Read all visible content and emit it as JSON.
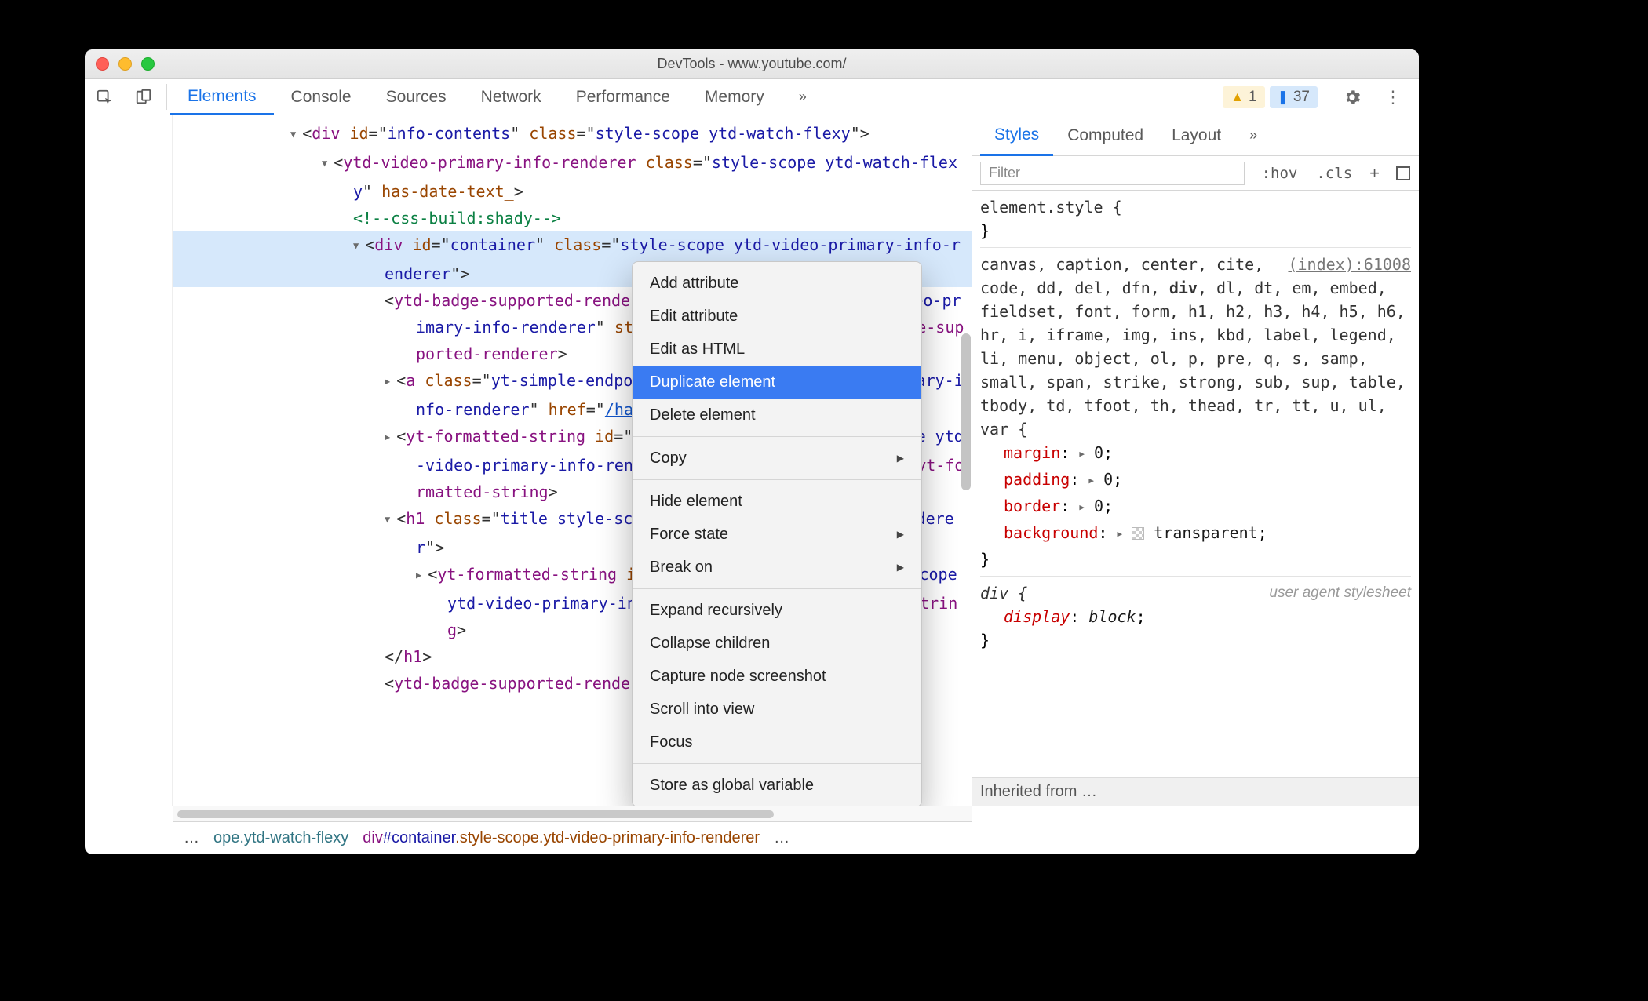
{
  "title": "DevTools - www.youtube.com/",
  "toolbar_tabs": {
    "elements": "Elements",
    "console": "Console",
    "sources": "Sources",
    "network": "Network",
    "performance": "Performance",
    "memory": "Memory"
  },
  "warnings_count": "1",
  "messages_count": "37",
  "dom": {
    "l1": "<div id=\"info-contents\" class=\"style-scope ytd-watch-flexy\">",
    "l2": "<ytd-video-primary-info-renderer class=\"style-scope ytd-watch-flexy\" has-date-text_>",
    "l3": "<!--css-build:shady-->",
    "l4": "<div id=\"container\" class=\"style-scope ytd-video-primary-info-renderer\">",
    "l5": "<ytd-badge-supported-renderer class=\"style-scope ytd-video-primary-info-renderer\" style-upgrade hidden>…</ytd-badge-supported-renderer>",
    "l6_pre": "<a class=\"yt-simple-endpoint style-scope ytd-video-primary-info-renderer\" href=\"",
    "l6_link": "/hashtag/chromedevsummit",
    "l6_post": "\">…</a>",
    "l7": "<yt-formatted-string id=\"super-title\" class=\"style-scope ytd-video-primary-info-renderer\" force-default-style>…</yt-formatted-string>",
    "l8": "<h1 class=\"title style-scope ytd-video-primary-info-renderer\">",
    "l9": "<yt-formatted-string id=\"video-title\" class=\"style-scope ytd-video-primary-info-renderer\">…</yt-formatted-string>",
    "l10": "</h1>",
    "l11": "<ytd-badge-supported-renderer class=\"style-scop"
  },
  "gutter_dots": "…",
  "context_menu": {
    "add_attribute": "Add attribute",
    "edit_attribute": "Edit attribute",
    "edit_html": "Edit as HTML",
    "duplicate": "Duplicate element",
    "delete": "Delete element",
    "copy": "Copy",
    "hide": "Hide element",
    "force_state": "Force state",
    "break_on": "Break on",
    "expand": "Expand recursively",
    "collapse": "Collapse children",
    "capture": "Capture node screenshot",
    "scroll": "Scroll into view",
    "focus": "Focus",
    "store": "Store as global variable"
  },
  "breadcrumb": {
    "dots_left": "…",
    "c1": "ope.ytd-watch-flexy",
    "c2_tag": "div",
    "c2_id": "#container",
    "c2_cls": ".style-scope.ytd-video-primary-info-renderer",
    "dots_right": "…"
  },
  "styles_panel": {
    "tabs": {
      "styles": "Styles",
      "computed": "Computed",
      "layout": "Layout"
    },
    "filter_placeholder": "Filter",
    "hov": ":hov",
    "cls": ".cls",
    "element_style_sel": "element.style {",
    "element_style_close": "}",
    "reset_selector": "canvas, caption, center, cite, code, dd, del, dfn, div, dl, dt, em, embed, fieldset, font, form, h1, h2, h3, h4, h5, h6, hr, i, iframe, img, ins, kbd, label, legend, li, menu, object, ol, p, pre, q, s, samp, small, span, strike, strong, sub, sup, table, tbody, td, tfoot, th, thead, tr, tt, u, ul, var {",
    "reset_close": "}",
    "reset_source": "(index):61008",
    "props": {
      "margin_name": "margin",
      "margin_val": "0",
      "padding_name": "padding",
      "padding_val": "0",
      "border_name": "border",
      "border_val": "0",
      "background_name": "background",
      "background_val": "transparent"
    },
    "ua_sel": "div {",
    "ua_label": "user agent stylesheet",
    "ua_prop_name": "display",
    "ua_prop_val": "block",
    "ua_close": "}",
    "inherited": "Inherited from …"
  }
}
